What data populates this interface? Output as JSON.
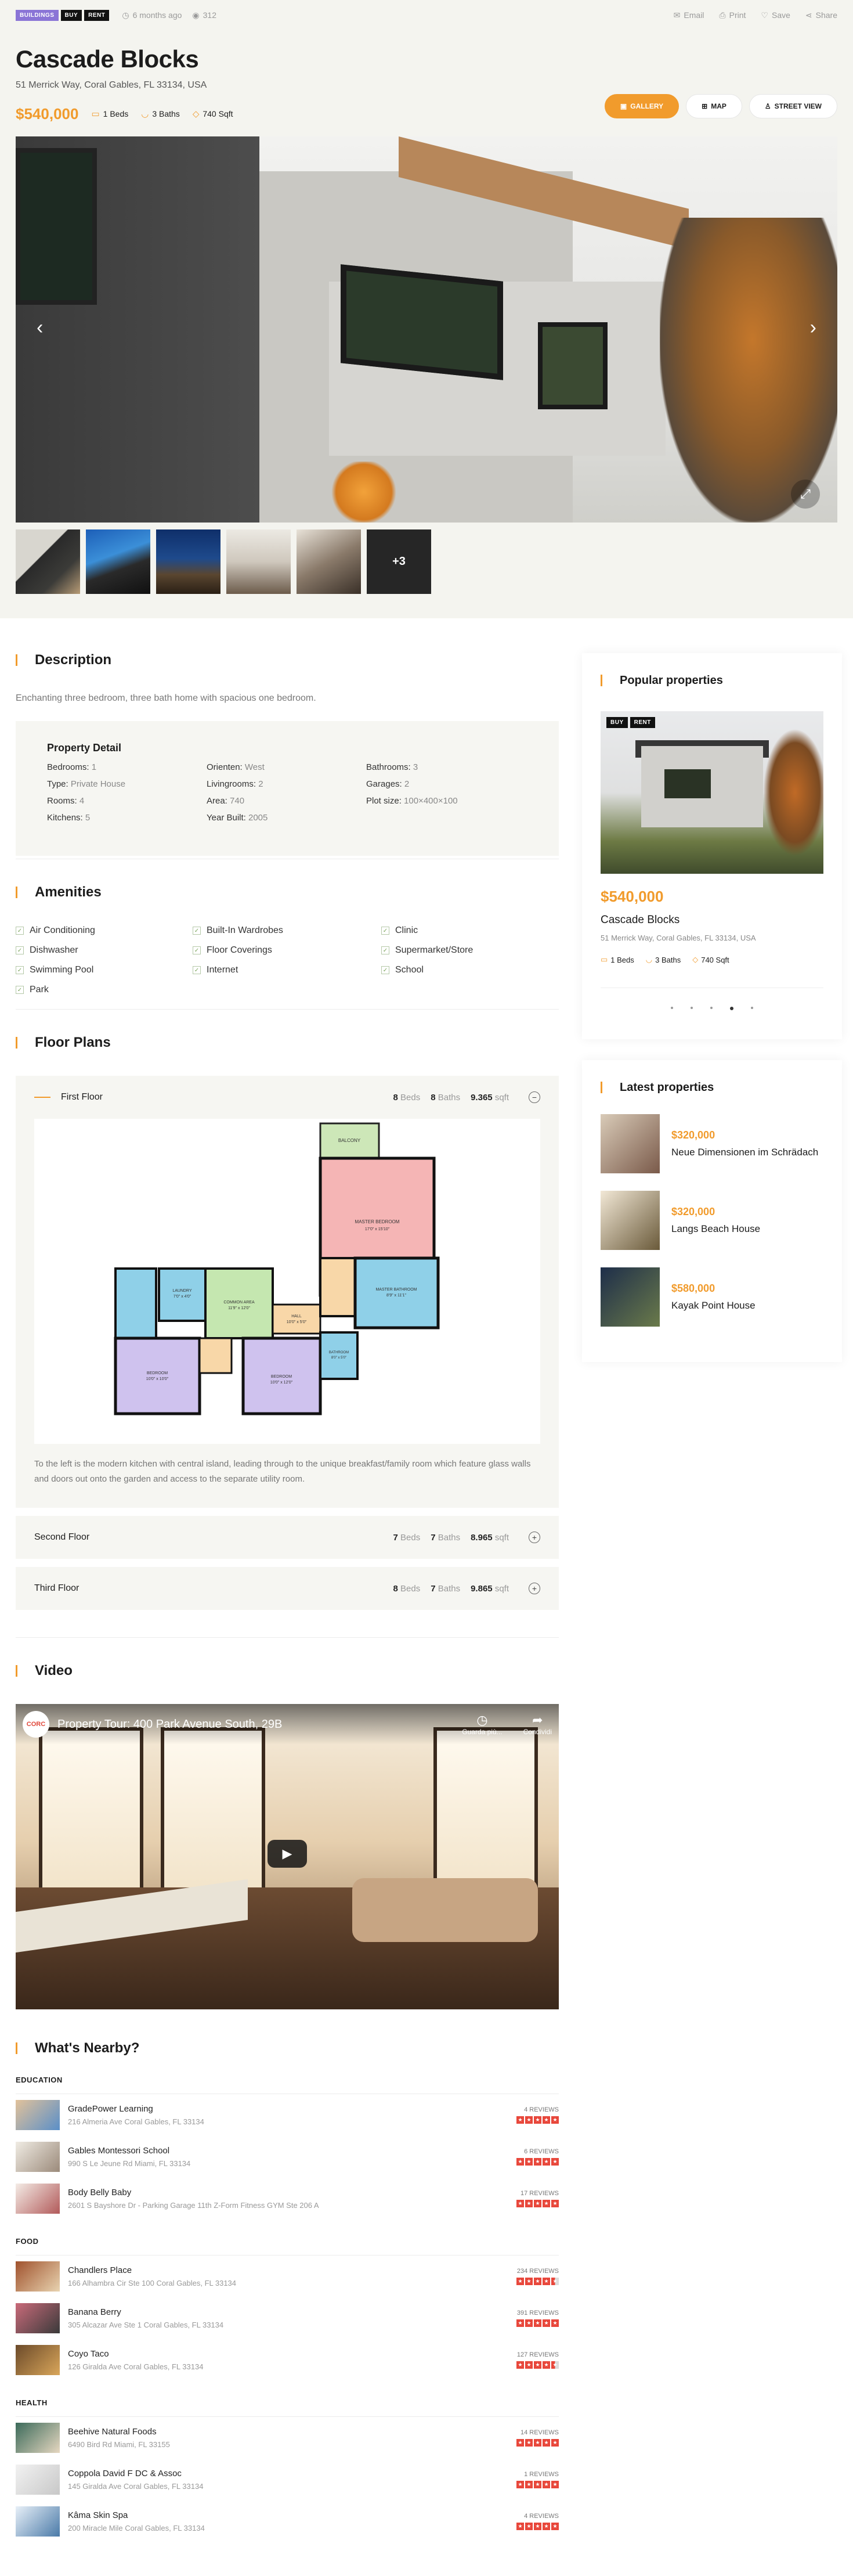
{
  "topbar": {
    "tags": [
      "BUILDINGS",
      "BUY",
      "RENT"
    ],
    "posted": "6 months ago",
    "views": "312",
    "actions": [
      "Email",
      "Print",
      "Save",
      "Share"
    ]
  },
  "property": {
    "title": "Cascade Blocks",
    "address": "51 Merrick Way, Coral Gables, FL 33134, USA",
    "price": "$540,000",
    "beds": "1 Beds",
    "baths": "3 Baths",
    "area": "740 Sqft"
  },
  "view_buttons": [
    "GALLERY",
    "MAP",
    "STREET VIEW"
  ],
  "gallery": {
    "more": "+3"
  },
  "description": {
    "title": "Description",
    "text": "Enchanting three bedroom, three bath home with spacious one bedroom."
  },
  "property_detail": {
    "title": "Property Detail",
    "items": [
      {
        "k": "Bedrooms:",
        "v": "1"
      },
      {
        "k": "Orienten:",
        "v": "West"
      },
      {
        "k": "Bathrooms:",
        "v": "3"
      },
      {
        "k": "Type:",
        "v": "Private House"
      },
      {
        "k": "Livingrooms:",
        "v": "2"
      },
      {
        "k": "Garages:",
        "v": "2"
      },
      {
        "k": "Rooms:",
        "v": "4"
      },
      {
        "k": "Area:",
        "v": "740"
      },
      {
        "k": "Plot size:",
        "v": "100×400×100"
      },
      {
        "k": "Kitchens:",
        "v": "5"
      },
      {
        "k": "Year Built:",
        "v": "2005"
      }
    ]
  },
  "amenities": {
    "title": "Amenities",
    "items": [
      "Air Conditioning",
      "Built-In Wardrobes",
      "Clinic",
      "Dishwasher",
      "Floor Coverings",
      "Supermarket/Store",
      "Swimming Pool",
      "Internet",
      "School",
      "Park"
    ]
  },
  "floor_plans": {
    "title": "Floor Plans",
    "beds_label": "Beds",
    "baths_label": "Baths",
    "sqft_label": "sqft",
    "floors": [
      {
        "name": "First Floor",
        "beds": "8",
        "baths": "8",
        "sqft": "9.365",
        "expanded": true,
        "text": "To the left is the modern kitchen with central island, leading through to the unique breakfast/family room which feature glass walls and doors out onto the garden and access to the separate utility room."
      },
      {
        "name": "Second Floor",
        "beds": "7",
        "baths": "7",
        "sqft": "8.965"
      },
      {
        "name": "Third Floor",
        "beds": "8",
        "baths": "7",
        "sqft": "9.865"
      }
    ],
    "plan_labels": {
      "balcony": "BALCONY",
      "master": "MASTER BEDROOM",
      "master_dim": "17'0\" x 15'10\"",
      "master_bath": "MASTER BATHROOM",
      "master_bath_dim": "8'9\" x 11'1\"",
      "laundry": "LAUNDRY",
      "laundry_dim": "7'0\" x 4'0\"",
      "common": "COMMON AREA",
      "common_dim": "11'9\" x 12'0\"",
      "hall": "HALL",
      "hall_dim": "10'0\" x 5'0\"",
      "bedroom1": "BEDROOM",
      "bedroom1_dim": "10'0\" x 10'0\"",
      "bedroom2": "BEDROOM",
      "bedroom2_dim": "10'0\" x 12'0\"",
      "bathroom": "BATHROOM",
      "bathroom_dim": "8'0\" x 5'0\""
    }
  },
  "video": {
    "title": "Video",
    "caption": "Property Tour: 400 Park Avenue South, 29B",
    "logo": "CORC",
    "later": "Guarda più...",
    "share": "Condividi"
  },
  "nearby": {
    "title": "What's Nearby?",
    "categories": [
      {
        "name": "EDUCATION",
        "places": [
          {
            "name": "GradePower Learning",
            "addr": "216 Almeria Ave Coral Gables, FL 33134",
            "reviews": "4 REVIEWS",
            "rating": 5
          },
          {
            "name": "Gables Montessori School",
            "addr": "990 S Le Jeune Rd Miami, FL 33134",
            "reviews": "6 REVIEWS",
            "rating": 5
          },
          {
            "name": "Body Belly Baby",
            "addr": "2601 S Bayshore Dr - Parking Garage 11th Z-Form Fitness GYM Ste 206 A",
            "reviews": "17 REVIEWS",
            "rating": 5
          }
        ]
      },
      {
        "name": "FOOD",
        "places": [
          {
            "name": "Chandlers Place",
            "addr": "166 Alhambra Cir Ste 100 Coral Gables, FL 33134",
            "reviews": "234 REVIEWS",
            "rating": 4.5
          },
          {
            "name": "Banana Berry",
            "addr": "305 Alcazar Ave Ste 1 Coral Gables, FL 33134",
            "reviews": "391 REVIEWS",
            "rating": 5
          },
          {
            "name": "Coyo Taco",
            "addr": "126 Giralda Ave Coral Gables, FL 33134",
            "reviews": "127 REVIEWS",
            "rating": 4.5
          }
        ]
      },
      {
        "name": "HEALTH",
        "places": [
          {
            "name": "Beehive Natural Foods",
            "addr": "6490 Bird Rd Miami, FL 33155",
            "reviews": "14 REVIEWS",
            "rating": 5
          },
          {
            "name": "Coppola David F DC & Assoc",
            "addr": "145 Giralda Ave Coral Gables, FL 33134",
            "reviews": "1 REVIEWS",
            "rating": 5
          },
          {
            "name": "Kâma Skin Spa",
            "addr": "200 Miracle Mile Coral Gables, FL 33134",
            "reviews": "4 REVIEWS",
            "rating": 5
          }
        ]
      }
    ]
  },
  "popular": {
    "title": "Popular properties",
    "tags": [
      "BUY",
      "RENT"
    ],
    "price": "$540,000",
    "name": "Cascade Blocks",
    "addr": "51 Merrick Way, Coral Gables, FL 33134, USA",
    "beds": "1 Beds",
    "baths": "3 Baths",
    "area": "740 Sqft",
    "active_dot": 3
  },
  "latest": {
    "title": "Latest properties",
    "items": [
      {
        "price": "$320,000",
        "name": "Neue Dimensionen im Schrädach"
      },
      {
        "price": "$320,000",
        "name": "Langs Beach House"
      },
      {
        "price": "$580,000",
        "name": "Kayak Point House"
      }
    ]
  },
  "colors": {
    "accent": "#f19b2c",
    "star": "#e8473b"
  }
}
